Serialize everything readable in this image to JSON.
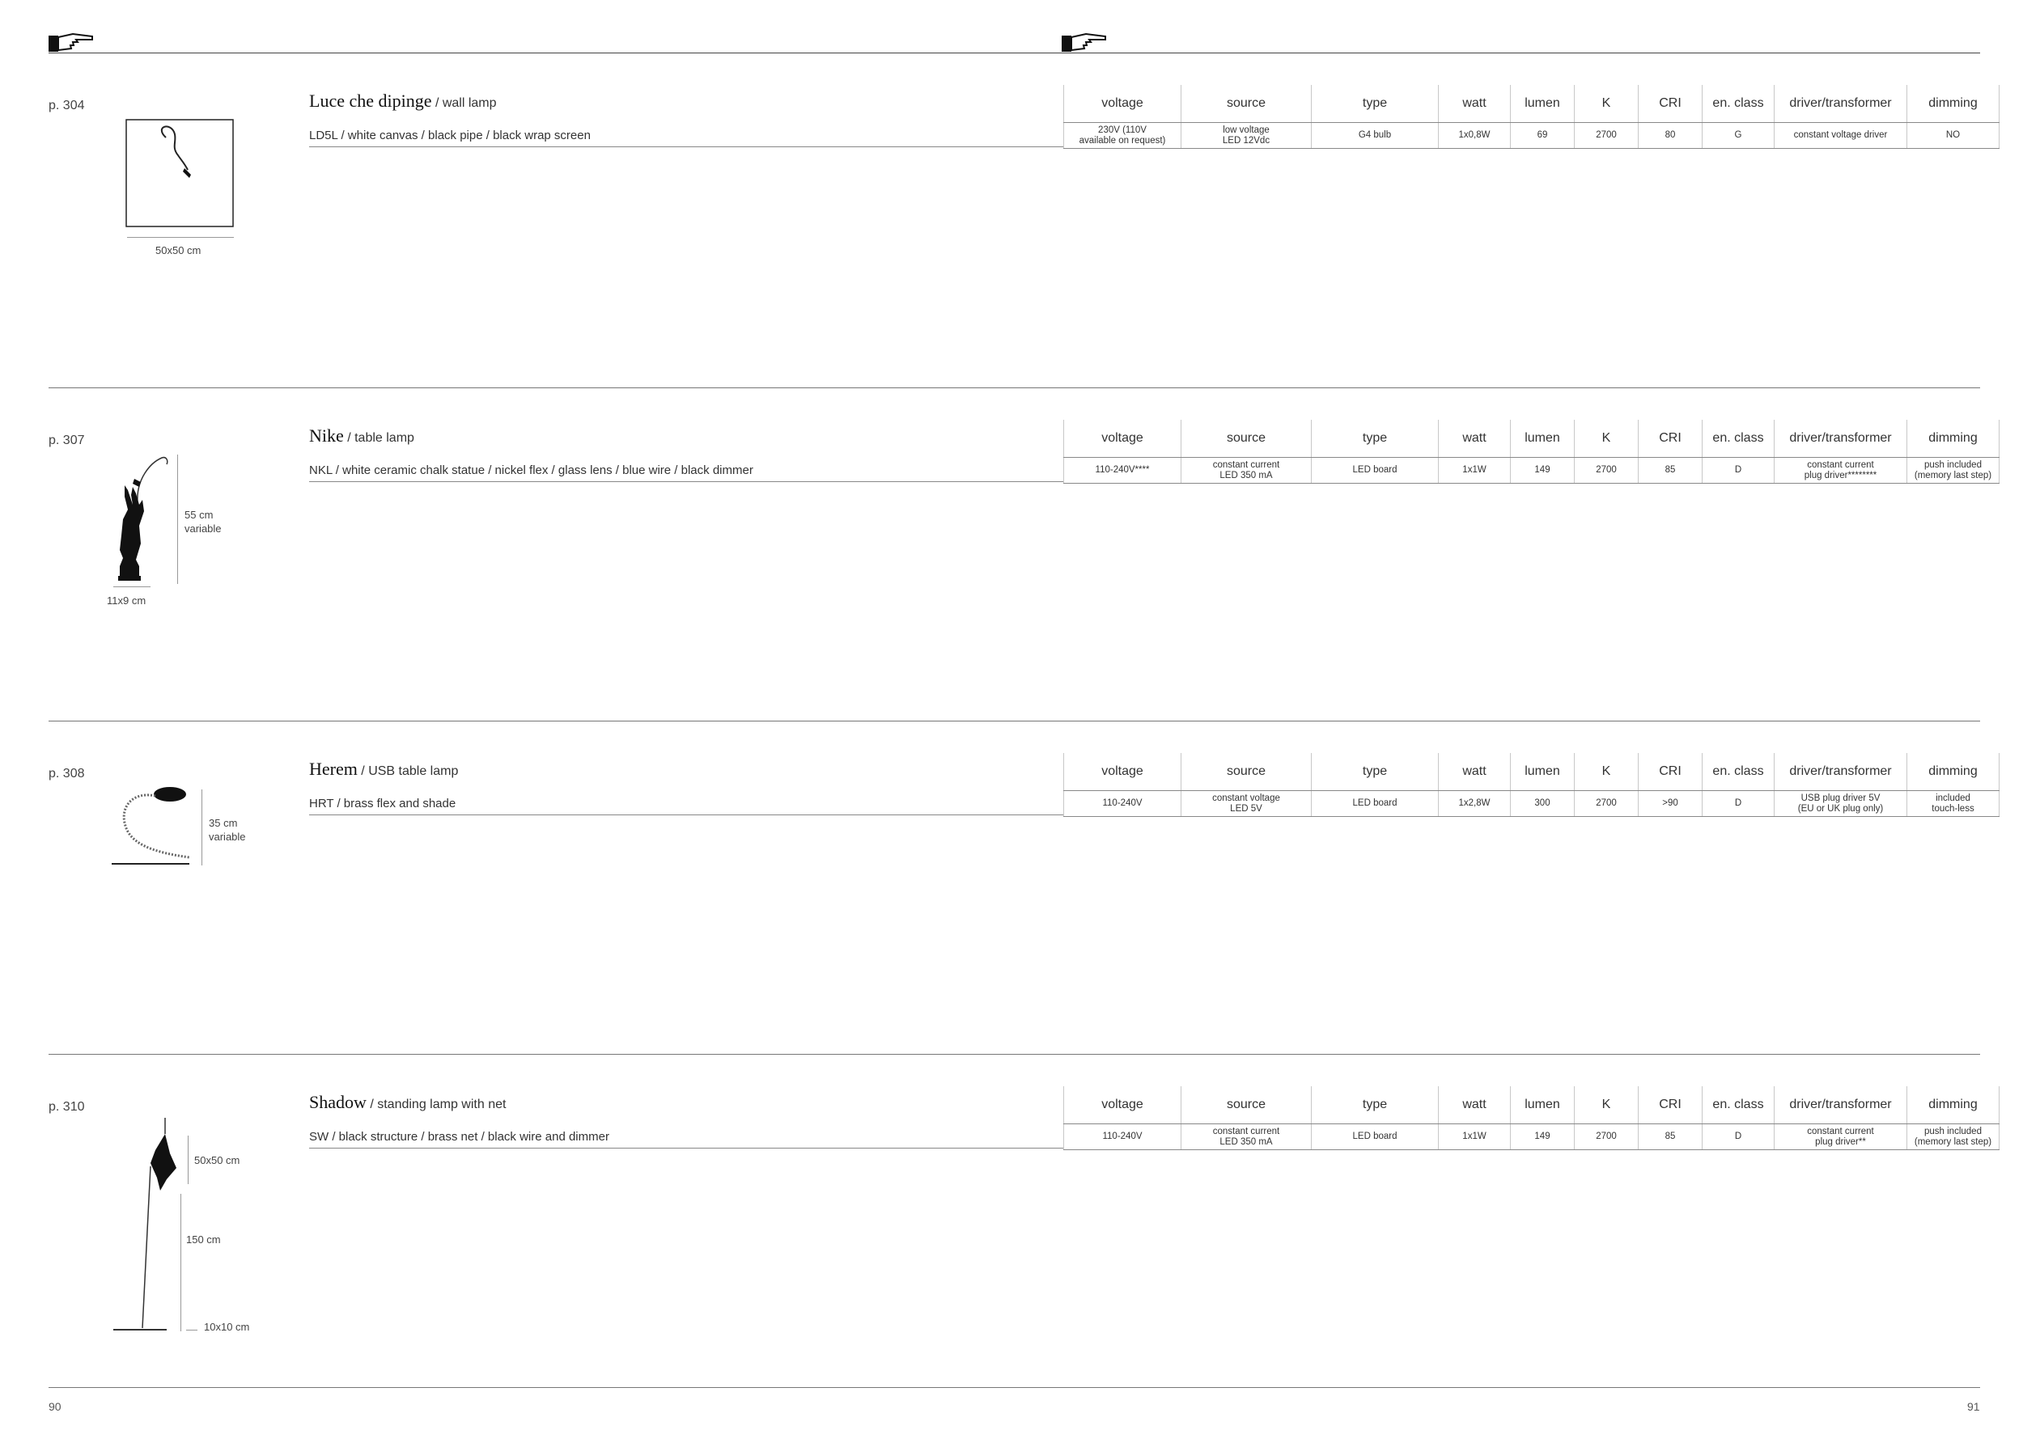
{
  "header": {
    "hand_icon": "pointing-hand-icon"
  },
  "columns": [
    "voltage",
    "source",
    "type",
    "watt",
    "lumen",
    "K",
    "CRI",
    "en. class",
    "driver/transformer",
    "dimming"
  ],
  "products": [
    {
      "page_ref": "p. 304",
      "name": "Luce che dipinge",
      "subtitle": " / wall lamp",
      "variant": "LD5L / white canvas / black pipe / black wrap screen",
      "specs": [
        "230V (110V\navailable on request)",
        "low voltage\nLED 12Vdc",
        "G4 bulb",
        "1x0,8W",
        "69",
        "2700",
        "80",
        "G",
        "constant voltage driver",
        "NO"
      ],
      "dims": [
        "50x50 cm"
      ]
    },
    {
      "page_ref": "p. 307",
      "name": "Nike",
      "subtitle": " / table lamp",
      "variant": "NKL / white ceramic chalk statue / nickel flex / glass lens / blue wire / black dimmer",
      "specs": [
        "110-240V****",
        "constant current\nLED 350 mA",
        "LED board",
        "1x1W",
        "149",
        "2700",
        "85",
        "D",
        "constant current\nplug driver********",
        "push included\n(memory last step)"
      ],
      "dims": [
        "55 cm\nvariable",
        "11x9 cm"
      ]
    },
    {
      "page_ref": "p. 308",
      "name": "Herem",
      "subtitle": " / USB table lamp",
      "variant": "HRT / brass flex and shade",
      "specs": [
        "110-240V",
        "constant voltage\nLED 5V",
        "LED board",
        "1x2,8W",
        "300",
        "2700",
        ">90",
        "D",
        "USB plug driver 5V\n(EU or UK plug only)",
        "included\ntouch-less"
      ],
      "dims": [
        "35 cm\nvariable"
      ]
    },
    {
      "page_ref": "p. 310",
      "name": "Shadow",
      "subtitle": " / standing lamp with net",
      "variant": "SW / black structure / brass net / black wire and dimmer",
      "specs": [
        "110-240V",
        "constant current\nLED 350 mA",
        "LED board",
        "1x1W",
        "149",
        "2700",
        "85",
        "D",
        "constant current\nplug driver**",
        "push included\n(memory last step)"
      ],
      "dims": [
        "50x50 cm",
        "150 cm",
        "10x10 cm"
      ]
    }
  ],
  "footer": {
    "page_left": "90",
    "page_right": "91"
  }
}
